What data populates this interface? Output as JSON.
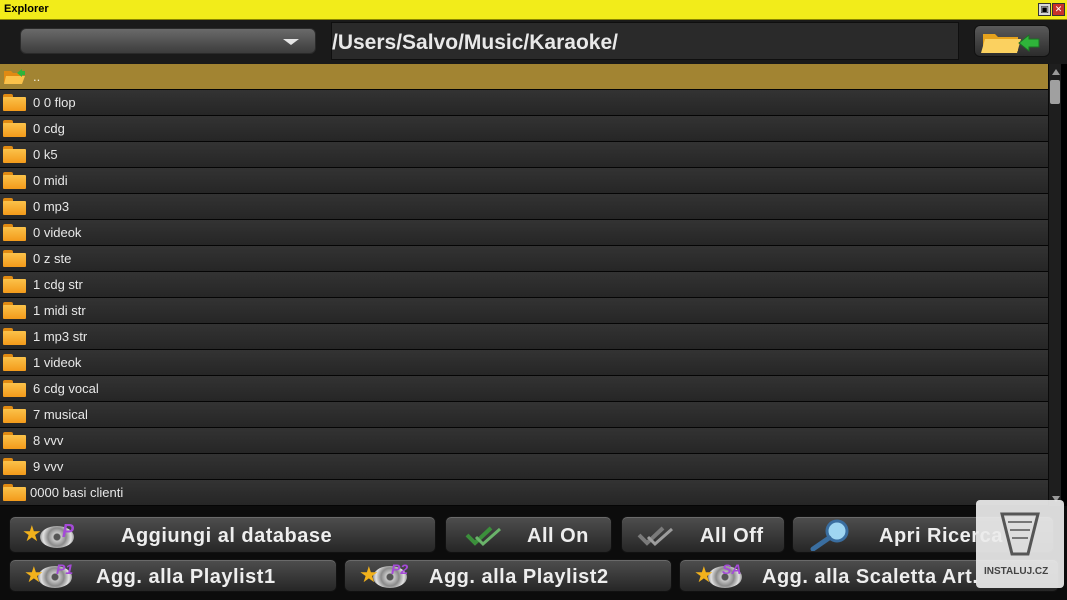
{
  "window": {
    "title": "Explorer",
    "restore_glyph": "▣",
    "close_glyph": "✕"
  },
  "toolbar": {
    "drive_value": "",
    "path": "/Users/Salvo/Music/Karaoke/",
    "up_button_icon": "folder-up-icon"
  },
  "list": {
    "parent_label": "..",
    "items": [
      "0 0 flop",
      "0 cdg",
      "0 k5",
      "0 midi",
      "0 mp3",
      "0 videok",
      "0 z ste",
      "1 cdg str",
      "1 midi str",
      "1 mp3 str",
      "1 videok",
      "6 cdg vocal",
      "7 musical",
      "8 vvv",
      "9 vvv",
      "0000 basi clienti"
    ]
  },
  "buttons": {
    "add_database": "Aggiungi al database",
    "all_on": "All On",
    "all_off": "All Off",
    "search": "Apri Ricerca",
    "playlist1": "Agg. alla Playlist1",
    "playlist2": "Agg. alla Playlist2",
    "scaletta": "Agg. alla Scaletta Art.",
    "badge_p": "P",
    "badge_p1": "P1",
    "badge_p2": "P2",
    "badge_sa": "SA"
  },
  "watermark": {
    "text": "INSTALUJ.CZ"
  },
  "colors": {
    "titlebar": "#f2ec1a",
    "selected_row": "#a28432",
    "folder": "#f7a928",
    "check_on": "#3b8f3b"
  }
}
